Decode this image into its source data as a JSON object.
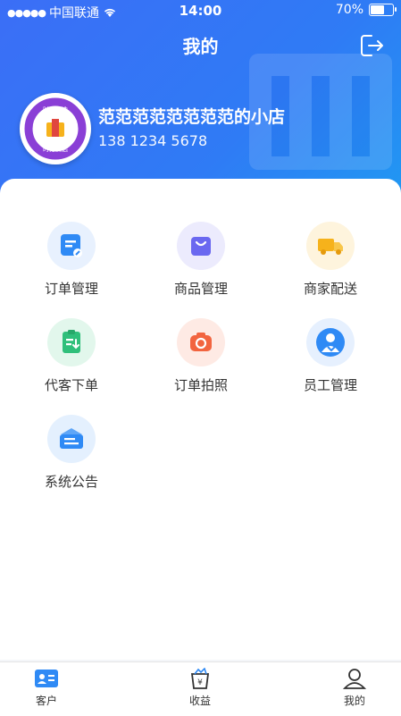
{
  "status_bar": {
    "carrier": "中国联通",
    "signal_dots": "●●●●●",
    "time": "14:00",
    "battery_text": "70%",
    "battery_level": 0.7
  },
  "header": {
    "title": "我的"
  },
  "profile": {
    "shop_name": "范范范范范范范范的小店",
    "phone": "138 1234 5678",
    "avatar_text_top": "时分优选",
    "avatar_text_bottom": "时分优选"
  },
  "menu": [
    {
      "label": "订单管理",
      "icon": "order-list-icon",
      "color": "#2f8af5"
    },
    {
      "label": "商品管理",
      "icon": "shopping-bag-icon",
      "color": "#6a68f0"
    },
    {
      "label": "商家配送",
      "icon": "delivery-truck-icon",
      "color": "#f6b21b"
    },
    {
      "label": "代客下单",
      "icon": "clipboard-download-icon",
      "color": "#2fbf7a"
    },
    {
      "label": "订单拍照",
      "icon": "camera-icon",
      "color": "#f2643f"
    },
    {
      "label": "员工管理",
      "icon": "staff-icon",
      "color": "#2f8af5"
    },
    {
      "label": "系统公告",
      "icon": "announcement-icon",
      "color": "#2f8af5"
    }
  ],
  "tabs": [
    {
      "label": "客户",
      "icon": "customer-card-icon"
    },
    {
      "label": "收益",
      "icon": "earnings-bag-icon"
    },
    {
      "label": "我的",
      "icon": "profile-icon"
    }
  ]
}
